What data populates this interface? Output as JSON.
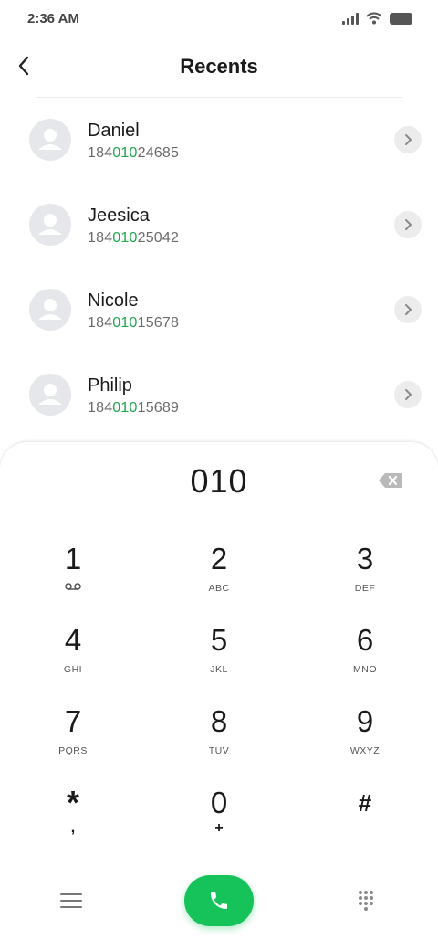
{
  "status_bar": {
    "time": "2:36 AM",
    "icons": [
      "signal-icon",
      "wifi-icon",
      "battery-icon"
    ]
  },
  "header": {
    "title": "Recents",
    "back_icon": "chevron-left-icon"
  },
  "search_query": "010",
  "contacts": [
    {
      "name": "Daniel",
      "number_pre": "184",
      "number_match": "010",
      "number_post": "24685"
    },
    {
      "name": "Jeesica",
      "number_pre": "184",
      "number_match": "010",
      "number_post": "25042"
    },
    {
      "name": "Nicole",
      "number_pre": "184",
      "number_match": "010",
      "number_post": "15678"
    },
    {
      "name": "Philip",
      "number_pre": "184",
      "number_match": "010",
      "number_post": "15689"
    }
  ],
  "dialpad": {
    "display": "010",
    "keys": [
      {
        "digit": "1",
        "letters": ""
      },
      {
        "digit": "2",
        "letters": "ABC"
      },
      {
        "digit": "3",
        "letters": "DEF"
      },
      {
        "digit": "4",
        "letters": "GHI"
      },
      {
        "digit": "5",
        "letters": "JKL"
      },
      {
        "digit": "6",
        "letters": "MNO"
      },
      {
        "digit": "7",
        "letters": "PQRS"
      },
      {
        "digit": "8",
        "letters": "TUV"
      },
      {
        "digit": "9",
        "letters": "WXYZ"
      },
      {
        "digit": "*",
        "letters": ","
      },
      {
        "digit": "0",
        "letters": "+"
      },
      {
        "digit": "#",
        "letters": ""
      }
    ]
  },
  "colors": {
    "accent_green": "#16c25a",
    "match_green": "#1fa84b",
    "text_primary": "#1a1a1a",
    "text_secondary": "#6b6b6b"
  }
}
